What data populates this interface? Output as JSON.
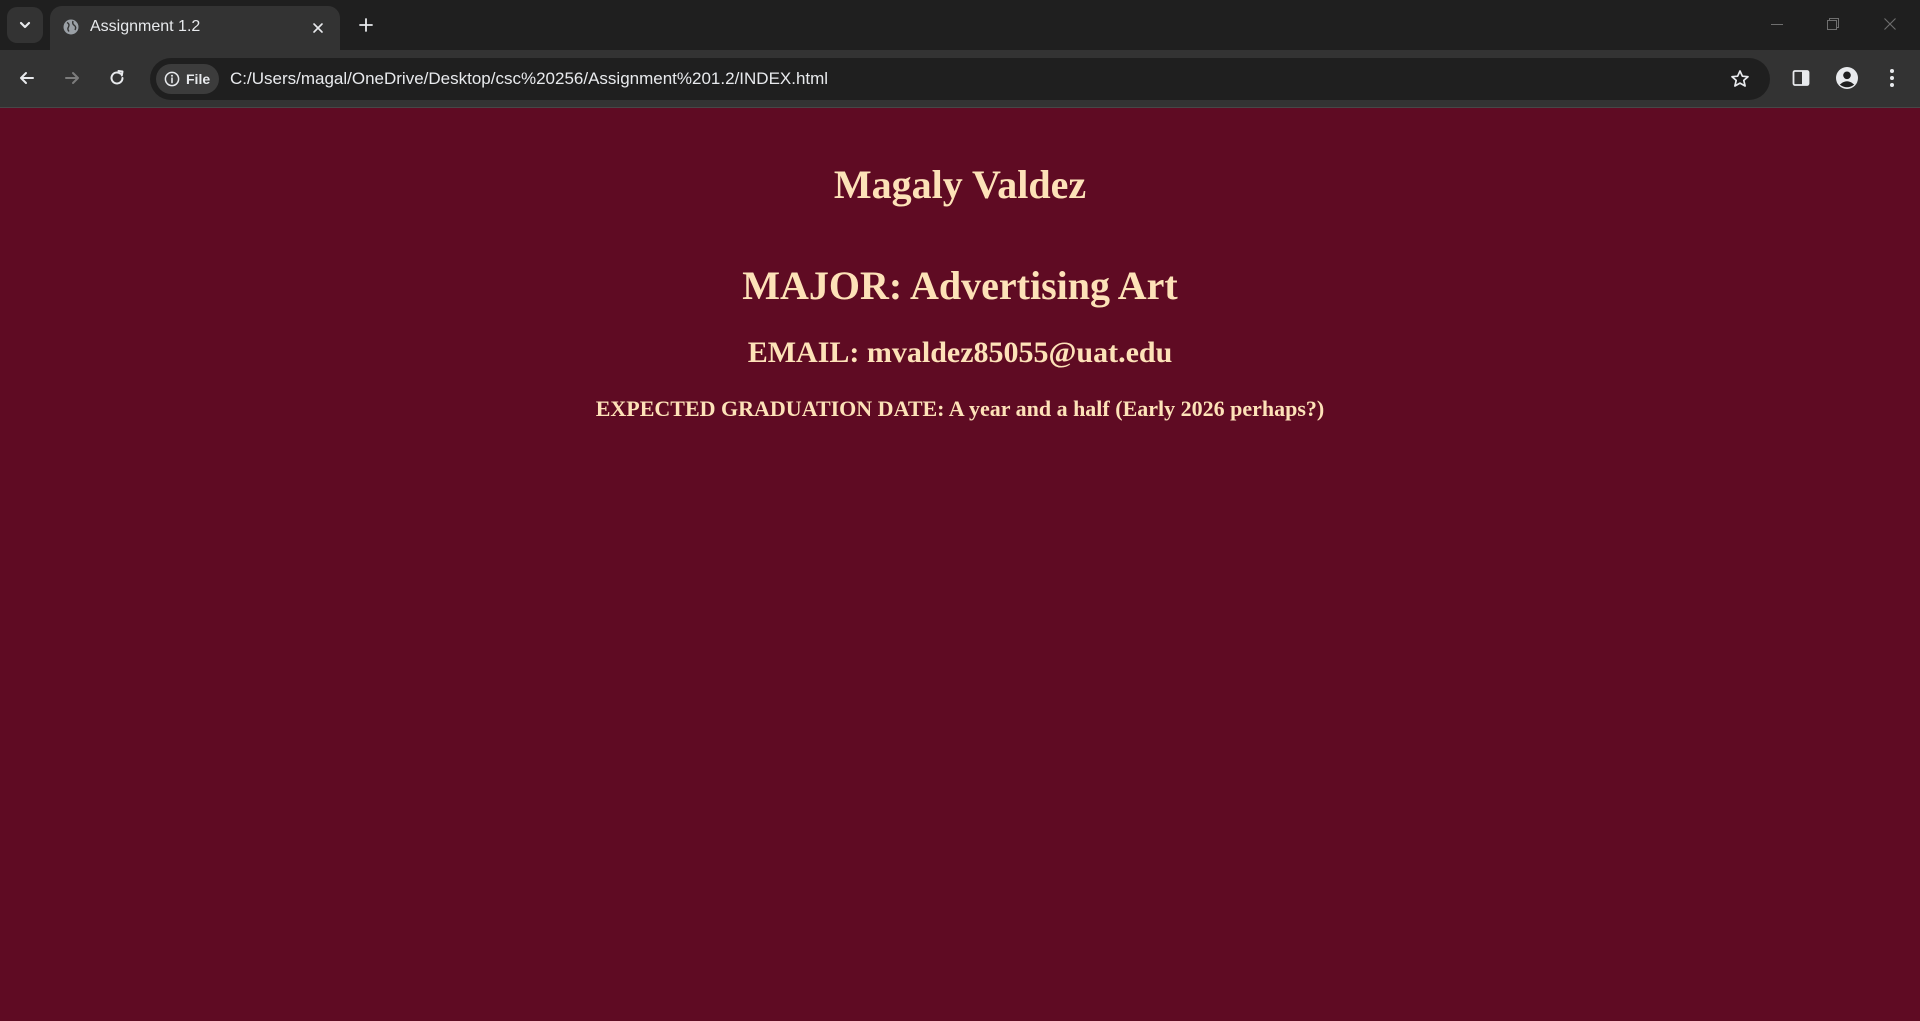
{
  "browser": {
    "tab": {
      "title": "Assignment 1.2"
    },
    "omnibox": {
      "chip_label": "File",
      "url": "C:/Users/magal/OneDrive/Desktop/csc%20256/Assignment%201.2/INDEX.html"
    },
    "icons": {
      "tab_search": "chevron-down-icon",
      "favicon": "globe-icon",
      "tab_close": "close-icon",
      "new_tab": "plus-icon",
      "minimize": "minimize-icon",
      "restore": "restore-icon",
      "close_window": "close-icon",
      "back": "arrow-left-icon",
      "forward": "arrow-right-icon",
      "reload": "reload-icon",
      "site_info": "info-icon",
      "bookmark": "star-icon",
      "side_panel": "side-panel-icon",
      "profile": "person-icon",
      "menu": "kebab-menu-icon"
    }
  },
  "page": {
    "name": "Magaly Valdez",
    "major": "MAJOR: Advertising Art",
    "email": "EMAIL: mvaldez85055@uat.edu",
    "graduation": "EXPECTED GRADUATION DATE: A year and a half (Early 2026 perhaps?)"
  },
  "colors": {
    "page_background": "#5f0b23",
    "page_text": "#fde2b8",
    "browser_titlebar": "#1f1f1f",
    "browser_toolbar": "#333333"
  }
}
